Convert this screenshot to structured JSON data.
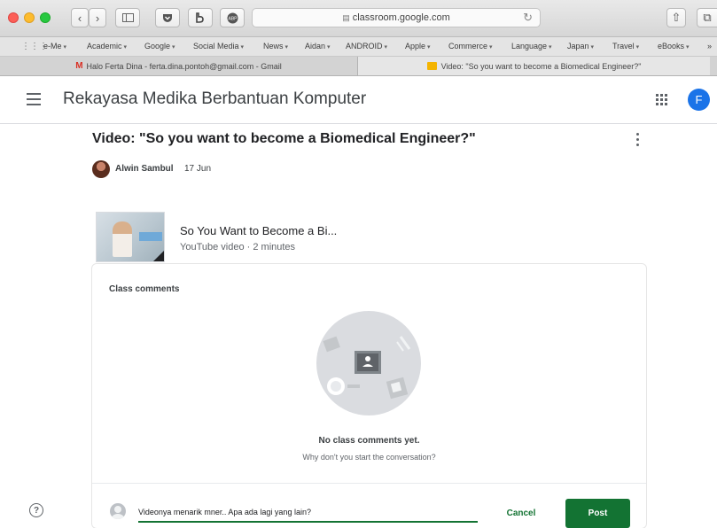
{
  "browser": {
    "url": "classroom.google.com",
    "bookmarks": [
      {
        "label": "e-Me"
      },
      {
        "label": "Academic"
      },
      {
        "label": "Google"
      },
      {
        "label": "Social Media"
      },
      {
        "label": "News"
      },
      {
        "label": "Aidan"
      },
      {
        "label": "ANDROID"
      },
      {
        "label": "Apple"
      },
      {
        "label": "Commerce"
      },
      {
        "label": "Language"
      },
      {
        "label": "Japan"
      },
      {
        "label": "Travel"
      },
      {
        "label": "eBooks"
      }
    ],
    "tabs": [
      {
        "label": "Halo Ferta Dina - ferta.dina.pontoh@gmail.com - Gmail"
      },
      {
        "label": "Video: \"So you want to become a Biomedical Engineer?\""
      }
    ]
  },
  "header": {
    "title": "Rekayasa Medika Berbantuan Komputer",
    "avatar_letter": "F"
  },
  "post": {
    "title": "Video: \"So you want to become a Biomedical Engineer?\"",
    "author": "Alwin Sambul",
    "date": "17 Jun",
    "attachment": {
      "title": "So You Want to Become a Bi...",
      "meta": "YouTube video · 2 minutes"
    }
  },
  "comments": {
    "heading": "Class comments",
    "empty_title": "No class comments yet.",
    "empty_subtitle": "Why don't you start the conversation?",
    "input_value": "Videonya menarik mner.. Apa ada lagi yang lain?",
    "cancel_label": "Cancel",
    "post_label": "Post"
  },
  "colors": {
    "accent_green": "#137333",
    "avatar_blue": "#1a73e8"
  }
}
